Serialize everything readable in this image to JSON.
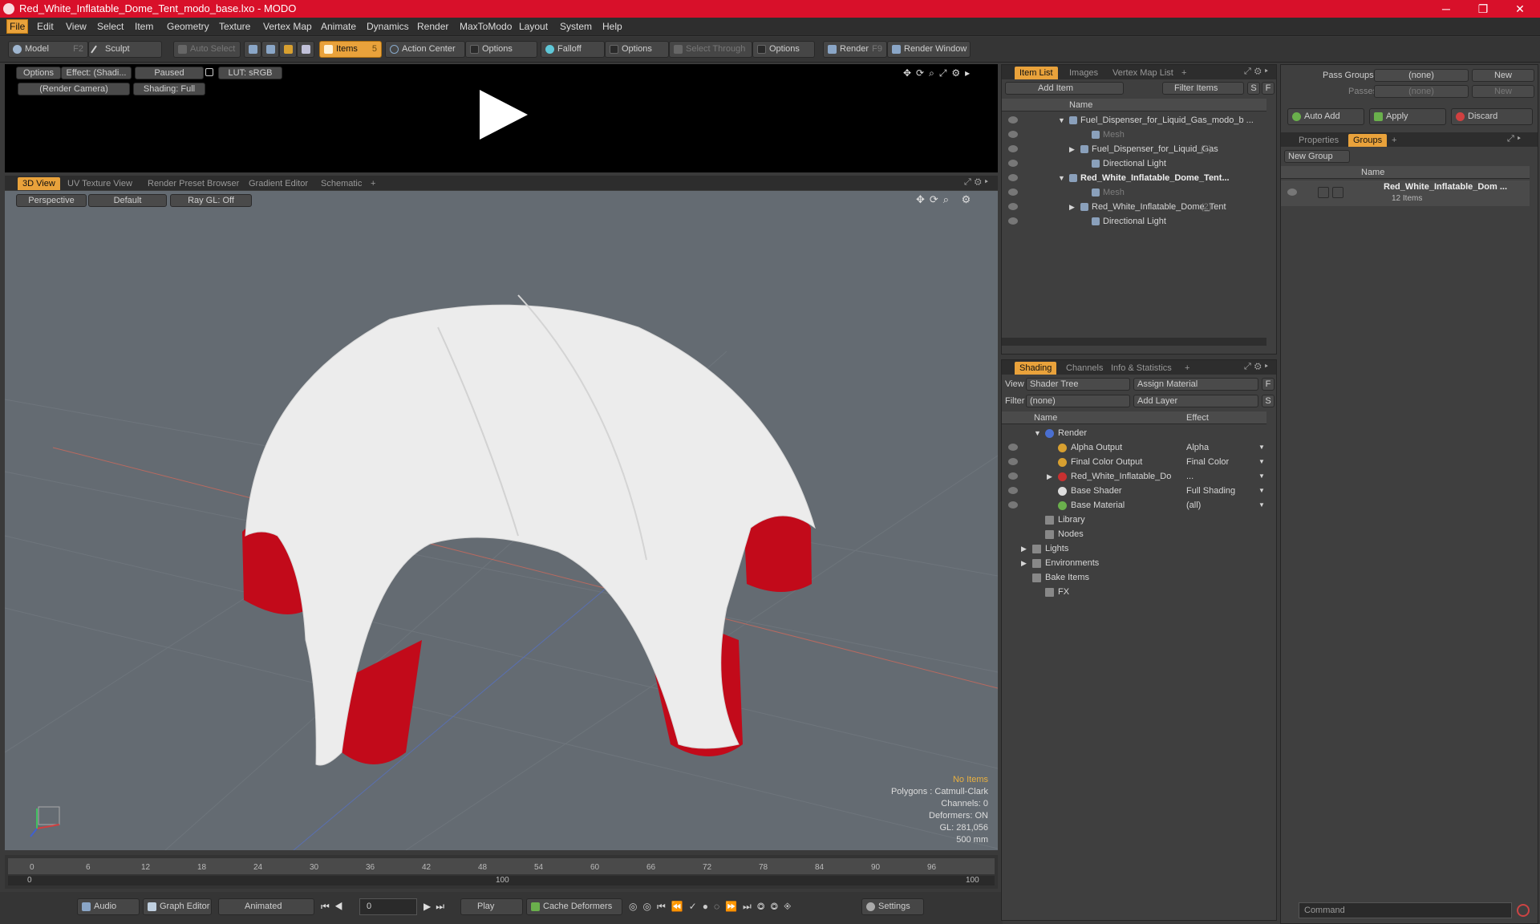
{
  "window": {
    "title": "Red_White_Inflatable_Dome_Tent_modo_base.lxo - MODO",
    "minimize": "─",
    "maximize": "❐",
    "close": "✕"
  },
  "menu": [
    "File",
    "Edit",
    "View",
    "Select",
    "Item",
    "Geometry",
    "Texture",
    "Vertex Map",
    "Animate",
    "Dynamics",
    "Render",
    "MaxToModo",
    "Layout",
    "System",
    "Help"
  ],
  "toolbar": {
    "model": "Model",
    "model_key": "F2",
    "sculpt": "Sculpt",
    "auto_select": "Auto Select",
    "items": "Items",
    "items_key": "5",
    "action_center": "Action Center",
    "options1": "Options",
    "falloff": "Falloff",
    "options2": "Options",
    "select_through": "Select Through",
    "options3": "Options",
    "render": "Render",
    "render_key": "F9",
    "render_window": "Render Window"
  },
  "preview": {
    "options": "Options",
    "effect": "Effect: (Shadi...",
    "paused": "Paused",
    "lut": "LUT: sRGB",
    "camera": "(Render Camera)",
    "shading": "Shading: Full"
  },
  "viewport_tabs": [
    "3D View",
    "UV Texture View",
    "Render Preset Browser",
    "Gradient Editor",
    "Schematic",
    "+"
  ],
  "viewport": {
    "perspective": "Perspective",
    "default": "Default",
    "raygl": "Ray GL: Off"
  },
  "stats": {
    "no_items": "No Items",
    "polygons": "Polygons : Catmull-Clark",
    "channels": "Channels: 0",
    "deformers": "Deformers: ON",
    "gl": "GL: 281,056",
    "scale": "500 mm"
  },
  "timeline": {
    "ticks": [
      "0",
      "6",
      "12",
      "18",
      "24",
      "30",
      "36",
      "42",
      "48",
      "54",
      "60",
      "66",
      "72",
      "78",
      "84",
      "90",
      "96"
    ],
    "sub_ticks": [
      "0",
      "100",
      "100"
    ]
  },
  "bottombar": {
    "audio": "Audio",
    "graph_editor": "Graph Editor",
    "animated": "Animated",
    "frame": "0",
    "play": "Play",
    "cache": "Cache Deformers",
    "settings": "Settings"
  },
  "itemlist": {
    "tabs": [
      "Item List",
      "Images",
      "Vertex Map List",
      "+"
    ],
    "add_item": "Add Item",
    "filter_items": "Filter Items",
    "s": "S",
    "f": "F",
    "col_name": "Name",
    "rows": [
      {
        "label": "Fuel_Dispenser_for_Liquid_Gas_modo_b ...",
        "cls": "",
        "indent": 0,
        "arrow": "▼"
      },
      {
        "label": "Mesh",
        "cls": "dimtxt",
        "indent": 2,
        "arrow": ""
      },
      {
        "label": "Fuel_Dispenser_for_Liquid_Gas",
        "extra": "(2)",
        "cls": "",
        "indent": 1,
        "arrow": "▶"
      },
      {
        "label": "Directional Light",
        "cls": "",
        "indent": 2,
        "arrow": ""
      },
      {
        "label": "Red_White_Inflatable_Dome_Tent...",
        "cls": "boldtxt",
        "indent": 0,
        "arrow": "▼"
      },
      {
        "label": "Mesh",
        "cls": "dimtxt",
        "indent": 2,
        "arrow": ""
      },
      {
        "label": "Red_White_Inflatable_Dome_Tent",
        "extra": "(2)",
        "cls": "",
        "indent": 1,
        "arrow": "▶"
      },
      {
        "label": "Directional Light",
        "cls": "",
        "indent": 2,
        "arrow": ""
      }
    ]
  },
  "shading": {
    "tabs": [
      "Shading",
      "Channels",
      "Info & Statistics",
      "+"
    ],
    "view_label": "View",
    "view_value": "Shader Tree",
    "assign_material": "Assign Material",
    "f": "F",
    "filter_label": "Filter",
    "filter_value": "(none)",
    "add_layer": "Add Layer",
    "s": "S",
    "col_name": "Name",
    "col_effect": "Effect",
    "rows": [
      {
        "label": "Render",
        "effect": "",
        "indent": 0,
        "arrow": "▼",
        "eye": false,
        "dot": "#4a6fd0"
      },
      {
        "label": "Alpha Output",
        "effect": "Alpha",
        "indent": 1,
        "arrow": "",
        "eye": true,
        "dot": "#d8a030"
      },
      {
        "label": "Final Color Output",
        "effect": "Final Color",
        "indent": 1,
        "arrow": "",
        "eye": true,
        "dot": "#d8a030"
      },
      {
        "label": "Red_White_Inflatable_Do",
        "effect": "...",
        "indent": 1,
        "arrow": "▶",
        "eye": true,
        "dot": "#c83030"
      },
      {
        "label": "Base Shader",
        "effect": "Full Shading",
        "indent": 1,
        "arrow": "",
        "eye": true,
        "dot": "#dddddd"
      },
      {
        "label": "Base Material",
        "effect": "(all)",
        "indent": 1,
        "arrow": "",
        "eye": true,
        "dot": "#6ab04c"
      },
      {
        "label": "Library",
        "effect": "",
        "indent": 0,
        "arrow": "",
        "eye": false,
        "dot": ""
      },
      {
        "label": "Nodes",
        "effect": "",
        "indent": 0,
        "arrow": "",
        "eye": false,
        "dot": ""
      },
      {
        "label": "Lights",
        "effect": "",
        "indent": -1,
        "arrow": "▶",
        "eye": false,
        "dot": ""
      },
      {
        "label": "Environments",
        "effect": "",
        "indent": -1,
        "arrow": "▶",
        "eye": false,
        "dot": ""
      },
      {
        "label": "Bake Items",
        "effect": "",
        "indent": -1,
        "arrow": "",
        "eye": false,
        "dot": ""
      },
      {
        "label": "FX",
        "effect": "",
        "indent": 0,
        "arrow": "",
        "eye": false,
        "dot": ""
      }
    ]
  },
  "groups": {
    "pass_groups": "Pass Groups",
    "pass_groups_value": "(none)",
    "new": "New",
    "passes": "Passes",
    "passes_value": "(none)",
    "new2": "New",
    "auto_add": "Auto Add",
    "apply": "Apply",
    "discard": "Discard",
    "tabs": [
      "Properties",
      "Groups",
      "+"
    ],
    "new_group": "New Group",
    "col_name": "Name",
    "group_name": "Red_White_Inflatable_Dom ...",
    "group_count": "12 Items"
  },
  "command": {
    "placeholder": "Command"
  }
}
